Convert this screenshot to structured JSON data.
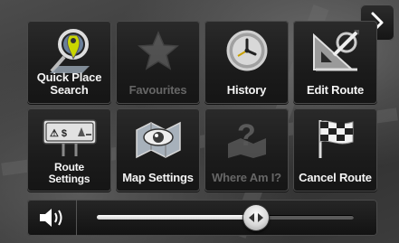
{
  "menu": {
    "items": [
      {
        "label_line1": "Quick Place",
        "label_line2": "Search",
        "icon": "quick-place-search-icon",
        "enabled": true
      },
      {
        "label_line1": "Favourites",
        "label_line2": "",
        "icon": "star-icon",
        "enabled": false
      },
      {
        "label_line1": "History",
        "label_line2": "",
        "icon": "clock-icon",
        "enabled": true
      },
      {
        "label_line1": "Edit Route",
        "label_line2": "",
        "icon": "edit-route-icon",
        "enabled": true
      },
      {
        "label_line1": "Route",
        "label_line2": "Settings",
        "icon": "road-sign-icon",
        "enabled": true
      },
      {
        "label_line1": "Map Settings",
        "label_line2": "",
        "icon": "map-eye-icon",
        "enabled": true
      },
      {
        "label_line1": "Where Am I?",
        "label_line2": "",
        "icon": "where-am-i-icon",
        "enabled": false
      },
      {
        "label_line1": "Cancel Route",
        "label_line2": "",
        "icon": "checkered-flag-icon",
        "enabled": true
      }
    ]
  },
  "navigation": {
    "next_icon": "chevron-right-icon"
  },
  "volume": {
    "icon": "speaker-icon",
    "level": 0.62
  },
  "colors": {
    "tile_bg": "#1b1b1b",
    "label": "#f4f4f4",
    "disabled_label": "#666666",
    "slider": "#ffffff"
  }
}
